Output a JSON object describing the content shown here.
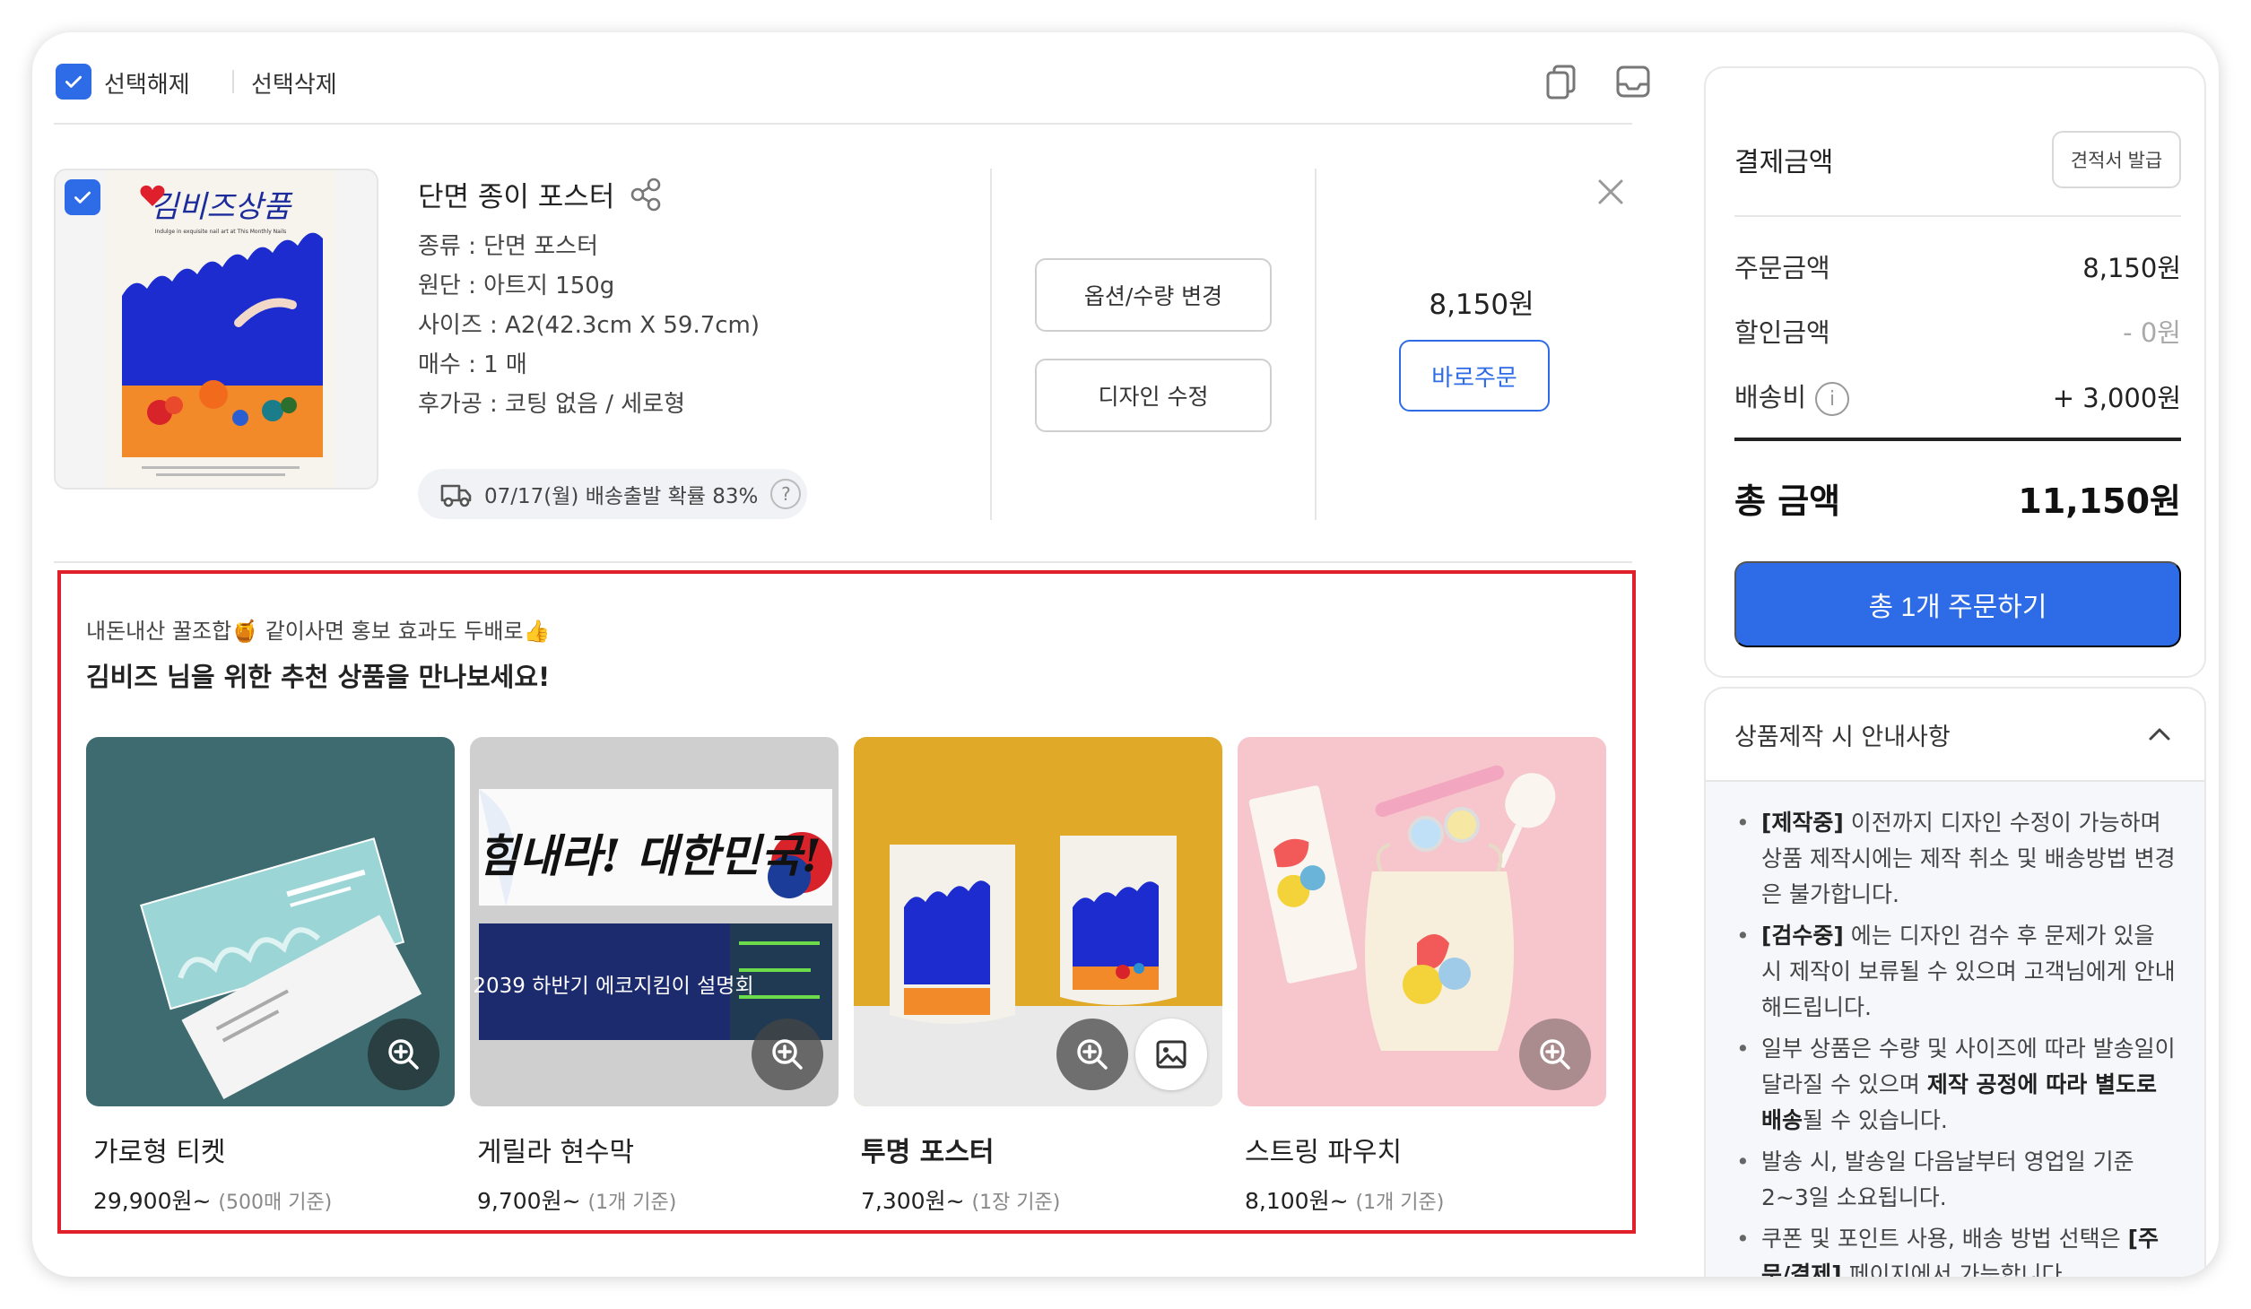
{
  "toolbar": {
    "deselect_label": "선택해제",
    "delete_label": "선택삭제"
  },
  "item": {
    "title": "단면 종이 포스터",
    "specs": [
      "종류 : 단면 포스터",
      "원단 : 아트지 150g",
      "사이즈 : A2(42.3cm X 59.7cm)",
      "매수 : 1 매",
      "후가공 : 코팅 없음 / 세로형"
    ],
    "shipping_note": "07/17(월) 배송출발 확률 83%",
    "shipping_help": "?",
    "option_button": "옵션/수량 변경",
    "design_button": "디자인 수정",
    "price": "8,150원",
    "buy_now_button": "바로주문",
    "thumbnail_brand_text": "김비즈상품",
    "thumbnail_tagline": "Indulge in exquisite nail art at This Monthly Nails"
  },
  "recommend": {
    "subtitle": "내돈내산 꿀조합🍯 같이사면 홍보 효과도 두배로👍",
    "heading": "김비즈 님을 위한 추천 상품을 만나보세요!",
    "cards": [
      {
        "name": "가로형 티켓",
        "price": "29,900원~",
        "basis": "(500매 기준)",
        "bg": "#3d6b70"
      },
      {
        "name": "게릴라 현수막",
        "price": "9,700원~",
        "basis": "(1개 기준)",
        "bg": "#cfcfcf"
      },
      {
        "name": "투명 포스터",
        "price": "7,300원~",
        "basis": "(1장 기준)",
        "bg": "#e0a928"
      },
      {
        "name": "스트링 파우치",
        "price": "8,100원~",
        "basis": "(1개 기준)",
        "bg": "#f6c6cc"
      }
    ],
    "banner_top_text": "힘내라! 대한민국!",
    "banner_bottom_text": "2039 하반기 에코지킴이 설명회"
  },
  "payment": {
    "title": "결제금액",
    "quote_button": "견적서 발급",
    "rows": [
      {
        "label": "주문금액",
        "value": "8,150원"
      },
      {
        "label": "할인금액",
        "value": "- 0원"
      },
      {
        "label": "배송비",
        "value": "+ 3,000원"
      }
    ],
    "info_icon_text": "i",
    "total_label": "총 금액",
    "total_value": "11,150원",
    "order_button": "총 1개 주문하기"
  },
  "guide": {
    "title": "상품제작 시 안내사항",
    "items": [
      {
        "strong": "[제작중]",
        "text": " 이전까지 디자인 수정이 가능하며 상품 제작시에는 제작 취소 및 배송방법 변경은 불가합니다."
      },
      {
        "strong": "[검수중]",
        "text": " 에는 디자인 검수 후 문제가 있을 시 제작이 보류될 수 있으며 고객님에게 안내해드립니다."
      },
      {
        "pre": "일부 상품은 수량 및 사이즈에 따라 발송일이 달라질 수 있으며 ",
        "strong": "제작 공정에 따라 별도로 배송",
        "text": "될 수 있습니다."
      },
      {
        "pre": "발송 시, 발송일 다음날부터 영업일 기준 2~3일 소요됩니다.",
        "strong": "",
        "text": ""
      },
      {
        "pre": "쿠폰 및 포인트 사용, 배송 방법 선택은 ",
        "strong": "[주문/결제]",
        "text": " 페이지에서 가능합니다."
      }
    ]
  },
  "colors": {
    "accent": "#2e6be6",
    "highlight_border": "#e0202a"
  }
}
